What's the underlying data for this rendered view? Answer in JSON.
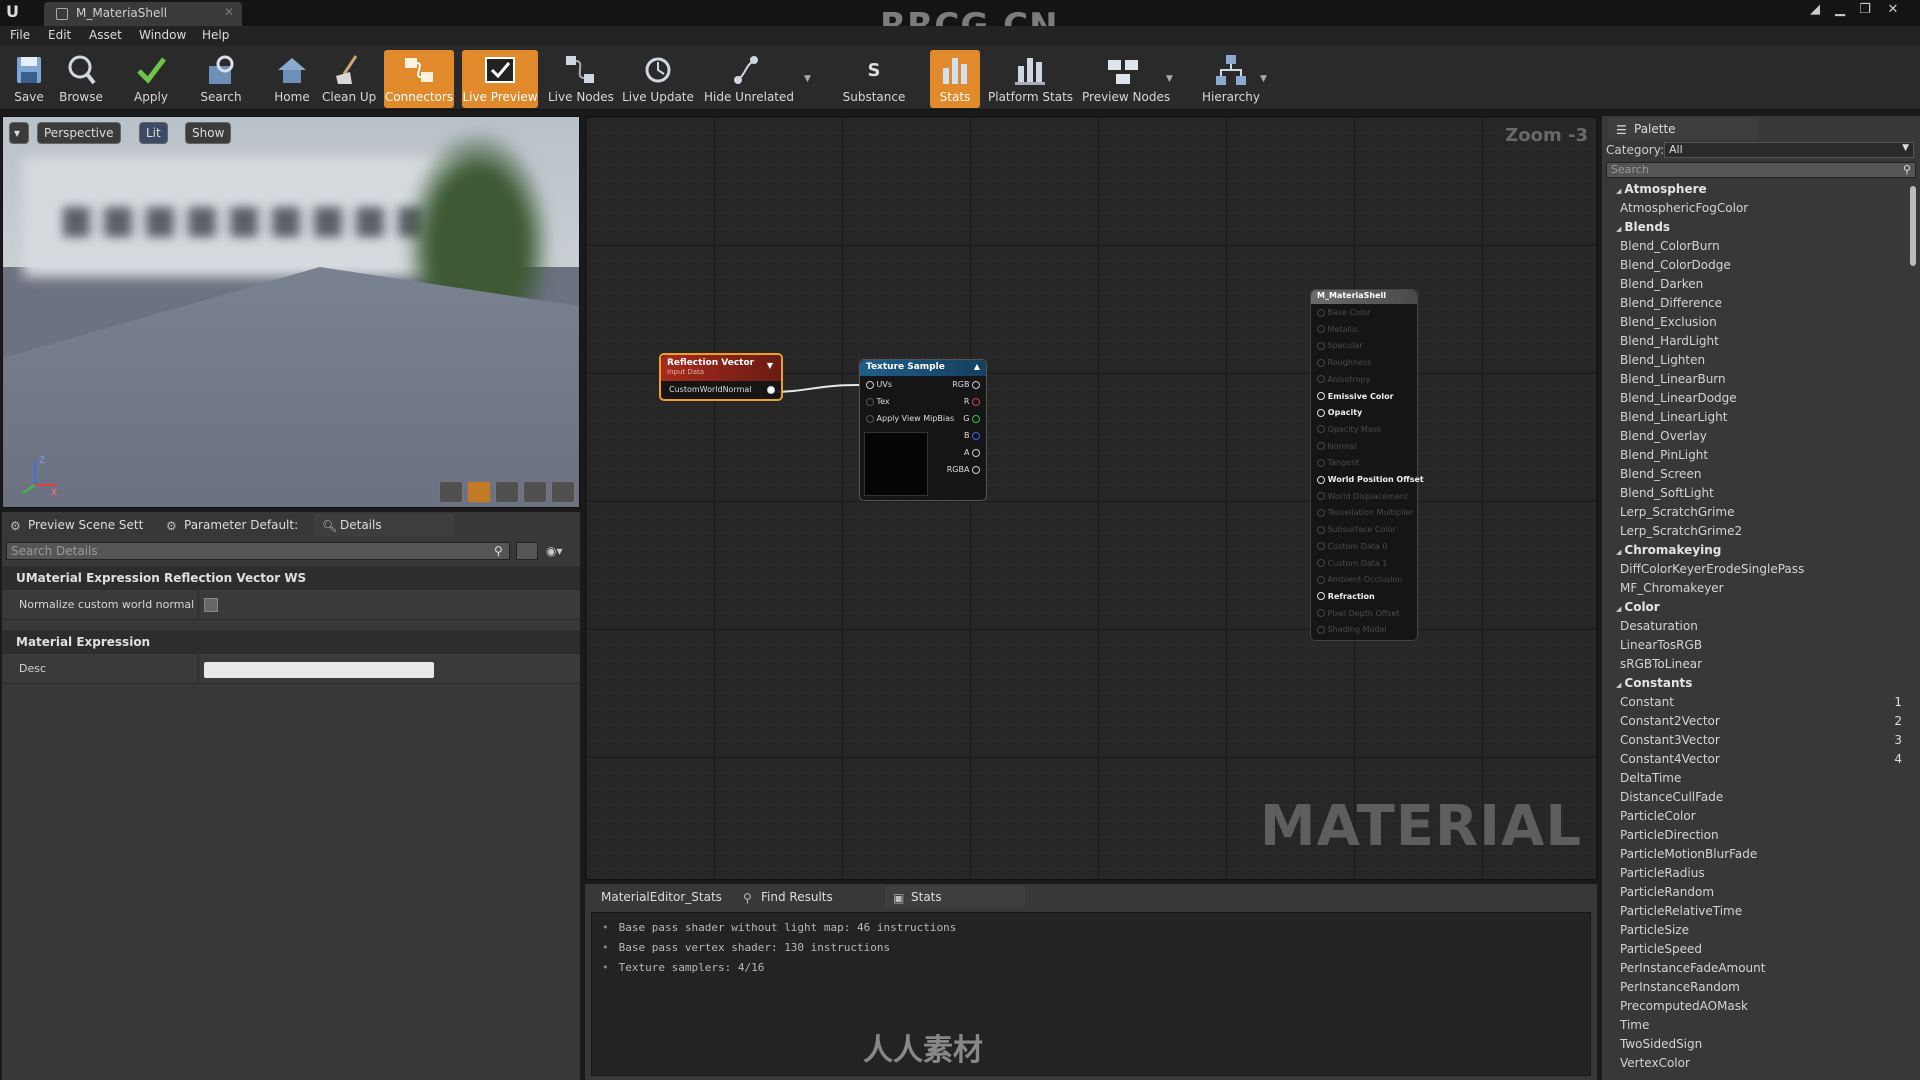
{
  "window": {
    "tab_title": "M_MateriaShell",
    "watermark_top": "RRCG.CN",
    "win_controls": [
      "▁",
      "❐",
      "✕"
    ]
  },
  "menu": [
    "File",
    "Edit",
    "Asset",
    "Window",
    "Help"
  ],
  "toolbar": {
    "buttons": [
      {
        "label": "Save",
        "icon": "save-icon"
      },
      {
        "label": "Browse",
        "icon": "browse-icon"
      },
      {
        "label": "Apply",
        "icon": "apply-icon"
      },
      {
        "label": "Search",
        "icon": "search-icon"
      },
      {
        "label": "Home",
        "icon": "home-icon"
      },
      {
        "label": "Clean Up",
        "icon": "cleanup-icon"
      },
      {
        "label": "Connectors",
        "icon": "connectors-icon",
        "active": true
      },
      {
        "label": "Live Preview",
        "icon": "live-preview-icon",
        "active": true
      },
      {
        "label": "Live Nodes",
        "icon": "live-nodes-icon"
      },
      {
        "label": "Live Update",
        "icon": "live-update-icon"
      },
      {
        "label": "Hide Unrelated",
        "icon": "hide-unrelated-icon"
      },
      {
        "label": "Substance",
        "icon": "substance-icon"
      },
      {
        "label": "Stats",
        "icon": "stats-icon",
        "active": true
      },
      {
        "label": "Platform Stats",
        "icon": "platform-stats-icon"
      },
      {
        "label": "Preview Nodes",
        "icon": "preview-nodes-icon"
      },
      {
        "label": "Hierarchy",
        "icon": "hierarchy-icon"
      }
    ],
    "accent": "#e08a2c"
  },
  "viewport": {
    "perspective": "Perspective",
    "lit": "Lit",
    "show": "Show"
  },
  "left_panel": {
    "tabs": [
      "Preview Scene Sett",
      "Parameter Default:",
      "Details"
    ],
    "search_placeholder": "Search Details",
    "section1": "UMaterial Expression Reflection Vector WS",
    "prop1_label": "Normalize custom world normal",
    "section2": "Material Expression",
    "prop2_label": "Desc",
    "prop2_value": ""
  },
  "graph": {
    "zoom": "Zoom -3",
    "watermark": "MATERIAL",
    "reflection_node": {
      "title": "Reflection Vector",
      "subtitle": "Input Data",
      "pin": "CustomWorldNormal"
    },
    "texture_node": {
      "title": "Texture Sample",
      "inputs": [
        "UVs",
        "Tex",
        "Apply View MipBias"
      ],
      "outputs": [
        "RGB",
        "R",
        "G",
        "B",
        "A",
        "RGBA"
      ]
    },
    "material_node": {
      "title": "M_MateriaShell",
      "pins": [
        "Base Color",
        "Metallic",
        "Specular",
        "Roughness",
        "Anisotropy",
        "Emissive Color",
        "Opacity",
        "Opacity Mask",
        "Normal",
        "Tangent",
        "World Position Offset",
        "World Displacement",
        "Tessellation Multiplier",
        "Subsurface Color",
        "Custom Data 0",
        "Custom Data 1",
        "Ambient Occlusion",
        "Refraction",
        "Pixel Depth Offset",
        "Shading Model"
      ],
      "active_pins": [
        "Emissive Color",
        "Opacity",
        "World Position Offset",
        "Refraction"
      ]
    }
  },
  "stats_panel": {
    "tabs": [
      "MaterialEditor_Stats",
      "Find Results",
      "Stats"
    ],
    "lines": [
      "Base pass shader without light map: 46 instructions",
      "Base pass vertex shader: 130 instructions",
      "Texture samplers: 4/16"
    ],
    "watermark": "人人素材"
  },
  "palette": {
    "tab": "Palette",
    "category_label": "Category:",
    "category_value": "All",
    "search_placeholder": "Search",
    "groups": [
      {
        "name": "Atmosphere",
        "items": [
          "AtmosphericFogColor"
        ]
      },
      {
        "name": "Blends",
        "items": [
          "Blend_ColorBurn",
          "Blend_ColorDodge",
          "Blend_Darken",
          "Blend_Difference",
          "Blend_Exclusion",
          "Blend_HardLight",
          "Blend_Lighten",
          "Blend_LinearBurn",
          "Blend_LinearDodge",
          "Blend_LinearLight",
          "Blend_Overlay",
          "Blend_PinLight",
          "Blend_Screen",
          "Blend_SoftLight",
          "Lerp_ScratchGrime",
          "Lerp_ScratchGrime2"
        ]
      },
      {
        "name": "Chromakeying",
        "items": [
          "DiffColorKeyerErodeSinglePass",
          "MF_Chromakeyer"
        ]
      },
      {
        "name": "Color",
        "items": [
          "Desaturation",
          "LinearTosRGB",
          "sRGBToLinear"
        ]
      },
      {
        "name": "Constants",
        "items": [
          "Constant",
          "Constant2Vector",
          "Constant3Vector",
          "Constant4Vector",
          "DeltaTime",
          "DistanceCullFade",
          "ParticleColor",
          "ParticleDirection",
          "ParticleMotionBlurFade",
          "ParticleRadius",
          "ParticleRandom",
          "ParticleRelativeTime",
          "ParticleSize",
          "ParticleSpeed",
          "PerInstanceFadeAmount",
          "PerInstanceRandom",
          "PrecomputedAOMask",
          "Time",
          "TwoSidedSign",
          "VertexColor"
        ],
        "hotkeys": [
          "1",
          "2",
          "3",
          "4"
        ]
      }
    ]
  }
}
